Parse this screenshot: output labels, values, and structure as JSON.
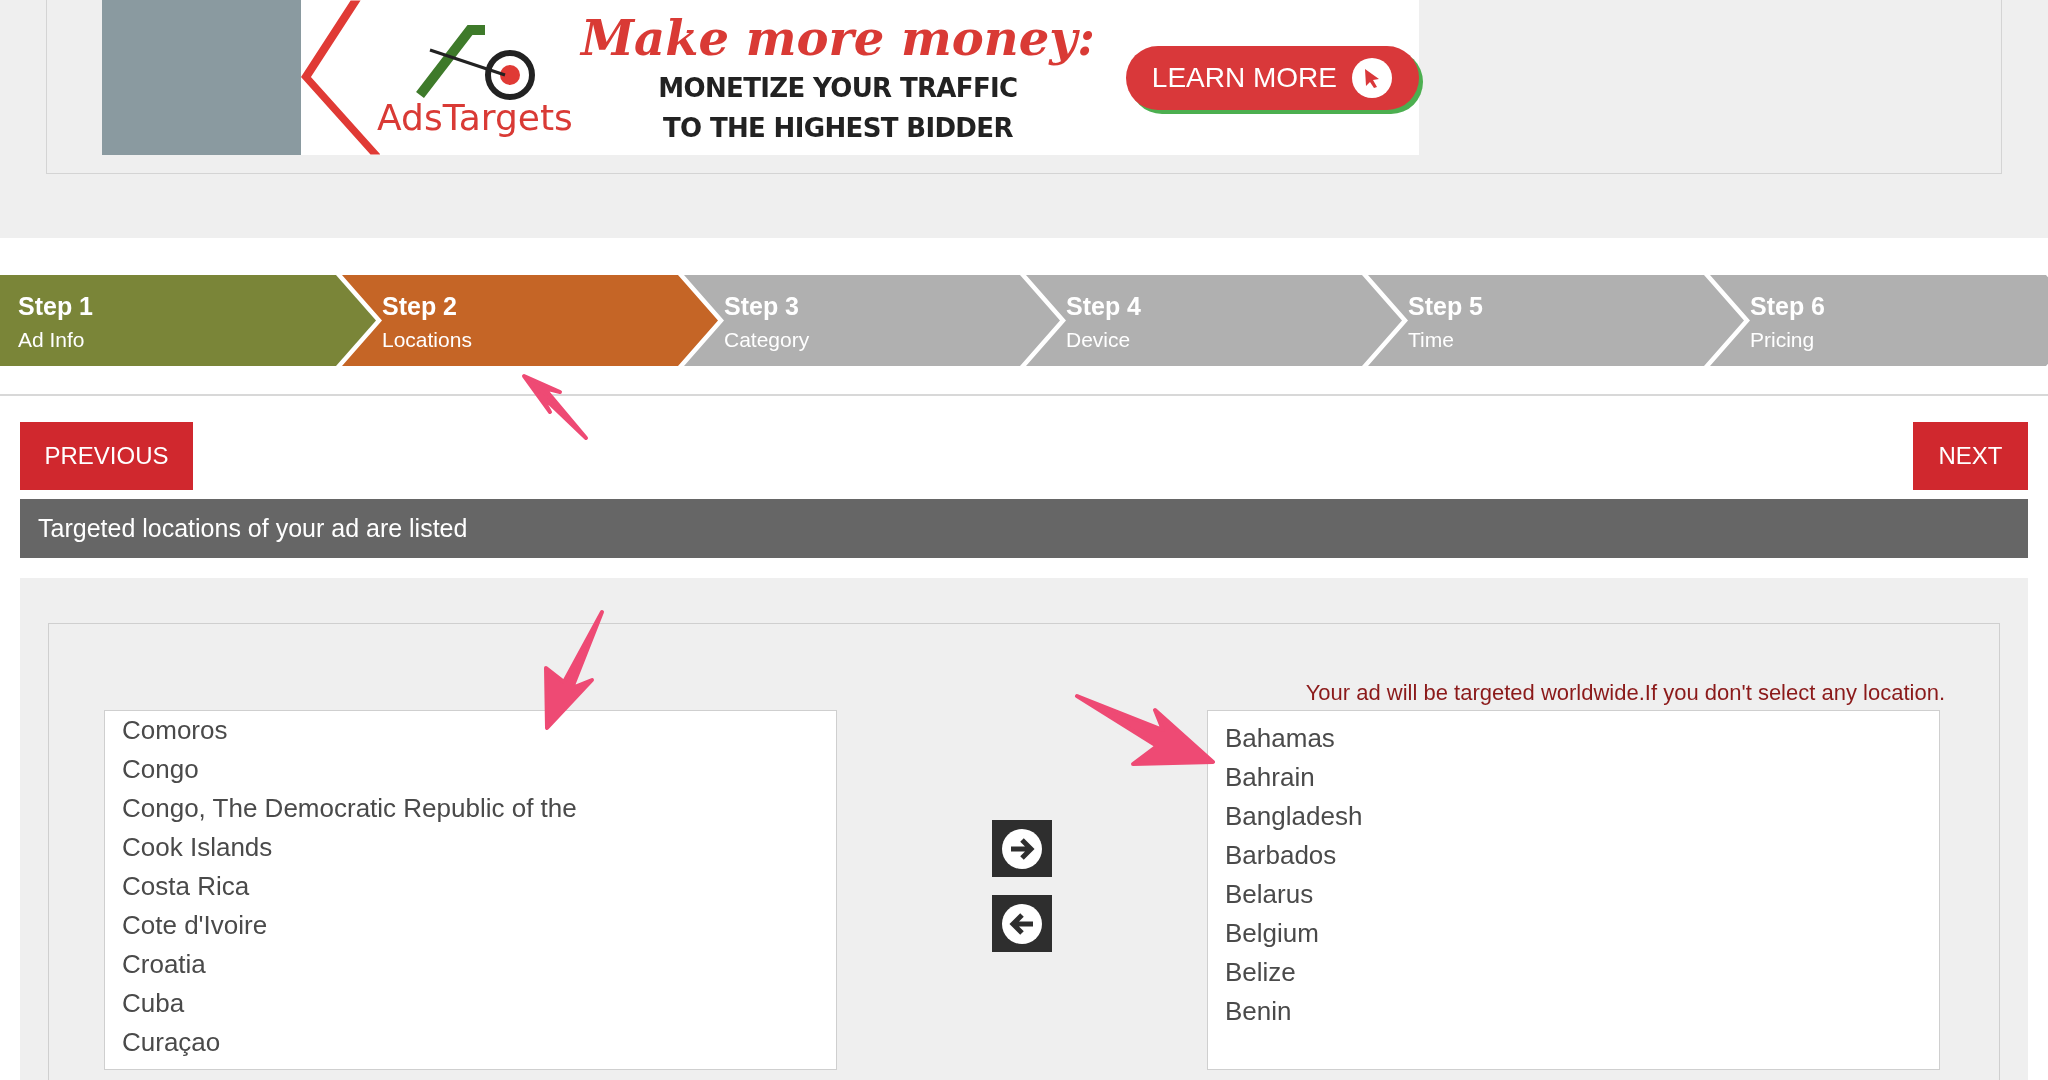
{
  "banner": {
    "brand": "AdsTargets",
    "headline": "Make more money:",
    "subline": "MONETIZE YOUR TRAFFIC TO THE HIGHEST BIDDER",
    "button": "LEARN MORE"
  },
  "steps": [
    {
      "title": "Step 1",
      "label": "Ad Info",
      "kind": "done"
    },
    {
      "title": "Step 2",
      "label": "Locations",
      "kind": "current"
    },
    {
      "title": "Step 3",
      "label": "Category",
      "kind": "pending"
    },
    {
      "title": "Step 4",
      "label": "Device",
      "kind": "pending"
    },
    {
      "title": "Step 5",
      "label": "Time",
      "kind": "pending"
    },
    {
      "title": "Step 6",
      "label": "Pricing",
      "kind": "pending"
    }
  ],
  "previous_button": "PREVIOUS",
  "next_button": "NEXT",
  "section_title": "Targeted locations of your ad are listed",
  "available_locations": [
    "Comoros",
    "Congo",
    "Congo, The Democratic Republic of the",
    "Cook Islands",
    "Costa Rica",
    "Cote d'Ivoire",
    "Croatia",
    "Cuba",
    "Curaçao"
  ],
  "worldwide_notice": "Your ad will be targeted worldwide.If you don't select any location.",
  "selected_locations": [
    "Bahamas",
    "Bahrain",
    "Bangladesh",
    "Barbados",
    "Belarus",
    "Belgium",
    "Belize",
    "Benin"
  ]
}
